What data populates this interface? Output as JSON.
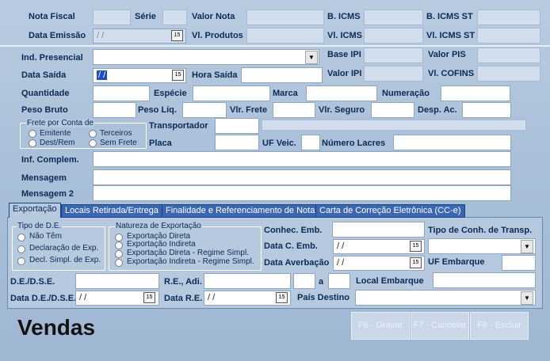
{
  "header": {
    "nota_fiscal": "Nota Fiscal",
    "serie": "Série",
    "valor_nota": "Valor Nota",
    "b_icms": "B. ICMS",
    "b_icms_st": "B. ICMS ST",
    "data_emissao": "Data Emissão",
    "data_emissao_value": " / /",
    "vl_produtos": "Vl. Produtos",
    "vl_icms": "Vl. ICMS",
    "vl_icms_st": "Vl. ICMS ST"
  },
  "form": {
    "ind_presencial": "Ind. Presencial",
    "base_ipi": "Base IPI",
    "valor_pis": "Valor PIS",
    "data_saida": "Data Saída",
    "data_saida_value": " / /",
    "hora_saida": "Hora Saída",
    "valor_ipi": "Valor IPI",
    "vl_cofins": "Vl. COFINS",
    "quantidade": "Quantidade",
    "especie": "Espécie",
    "marca": "Marca",
    "numeracao": "Numeração",
    "peso_bruto": "Peso Bruto",
    "peso_liq": "Peso Líq.",
    "vlr_frete": "Vlr. Frete",
    "vlr_seguro": "Vlr. Seguro",
    "desp_ac": "Desp. Ac.",
    "frete_group": "Frete por Conta de",
    "frete_options": [
      "Emitente",
      "Terceiros",
      "Dest/Rem",
      "Sem Frete"
    ],
    "transportador": "Transportador",
    "placa": "Placa",
    "uf_veic": "UF Veic.",
    "numero_lacres": "Número Lacres",
    "inf_complem": "Inf. Complem.",
    "mensagem": "Mensagem",
    "mensagem2": "Mensagem 2"
  },
  "tabs": [
    "Exportação",
    "Locais Retirada/Entrega",
    "Finalidade e Referenciamento de Nota",
    "Carta de Correção Eletrônica (CC-e)"
  ],
  "export": {
    "tipo_de_title": "Tipo de D.E.",
    "tipo_de_options": [
      "Não Têm",
      "Declaração de Exp.",
      "Decl. Simpl. de Exp."
    ],
    "natureza_title": "Natureza de Exportação",
    "natureza_options": [
      "Exportação Direta",
      "Exportação Indireta",
      "Exportação Direta - Regime Simpl.",
      "Exportação Indireta - Regime Simpl."
    ],
    "conhec_emb": "Conhec. Emb.",
    "tipo_conh": "Tipo de Conh. de Transp.",
    "data_c_emb": "Data C. Emb.",
    "data_c_emb_value": " / /",
    "data_averbacao": "Data Averbação",
    "data_averbacao_value": " / /",
    "uf_embarque": "UF Embarque",
    "de_dse": "D.E./D.S.E.",
    "re_adi": "R.E., Adi.",
    "a": "a",
    "local_embarque": "Local Embarque",
    "data_de_dse": "Data D.E./D.S.E.",
    "data_de_dse_value": " / /",
    "data_re": "Data R.E.",
    "data_re_value": " / /",
    "pais_destino": "País Destino"
  },
  "footer": {
    "title": "Vendas",
    "btn_gravar": "F6 - Gravar",
    "btn_cancelar": "F7 - Cancelar",
    "btn_excluir": "F8 - Excluir"
  },
  "calendar_icon_text": "15"
}
